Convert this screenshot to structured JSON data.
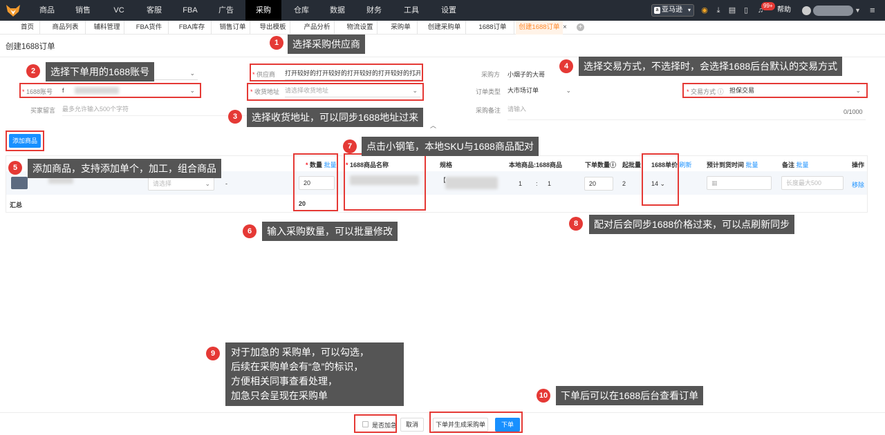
{
  "topnav": {
    "items": [
      "商品",
      "销售",
      "VC",
      "客服",
      "FBA",
      "广告",
      "采购",
      "仓库",
      "数据",
      "财务",
      "工具",
      "设置"
    ],
    "active": "采购",
    "marketplace": "亚马逊",
    "marketplace_icon": "a",
    "notification_badge": "99+",
    "help": "帮助"
  },
  "tabs": {
    "items": [
      "首页",
      "商品列表",
      "辅料管理",
      "FBA货件",
      "FBA库存",
      "销售订单",
      "导出模板",
      "产品分析",
      "物流设置",
      "采购单",
      "创建采购单",
      "1688订单",
      "创建1688订单"
    ],
    "active": "创建1688订单",
    "close": "×",
    "add": "+"
  },
  "page": {
    "title": "创建1688订单"
  },
  "form": {
    "supplier_label": "供应商",
    "supplier_value": "打开较好的打开较好的打开较好的打开较好的打开较",
    "purchaser_label": "采购方",
    "purchaser_value": "小烟子的大哥",
    "account_label": "1688账号",
    "account_prefix": "f",
    "address_label": "收货地址",
    "address_placeholder": "请选择收货地址",
    "order_type_label": "订单类型",
    "order_type_value": "大市场订单",
    "trade_label": "交易方式",
    "trade_value": "担保交易",
    "buyer_msg_label": "买家留言",
    "buyer_msg_placeholder": "最多允许输入500个字符",
    "remark_label": "采购备注",
    "remark_placeholder": "请输入",
    "remark_count": "0/1000"
  },
  "add_product_button": "添加商品",
  "table": {
    "headers": {
      "qty": "数量",
      "batch": "批量",
      "name_1688": "1688商品名称",
      "spec": "规格",
      "mapping": "本地商品:1688商品",
      "order_qty": "下单数量",
      "min_batch": "起批量",
      "unit_price": "1688单价",
      "refresh": "刷新",
      "eta": "预计到货时间",
      "note": "备注",
      "ops": "操作"
    },
    "row": {
      "select_placeholder": "请选择",
      "dash": "-",
      "qty": "20",
      "spec_prefix": "【",
      "ratio_left": "1",
      "ratio_colon": ":",
      "ratio_right": "1",
      "order_qty": "20",
      "min_batch": "2",
      "price": "14",
      "note_placeholder": "长度最大500",
      "remove": "移除"
    },
    "total_label": "汇总",
    "total_qty": "20"
  },
  "footer": {
    "urgent_label": "是否加急",
    "cancel": "取消",
    "order_and_po": "下单并生成采购单",
    "order": "下单"
  },
  "callouts": [
    {
      "n": "1",
      "text": "选择采购供应商"
    },
    {
      "n": "2",
      "text": "选择下单用的1688账号"
    },
    {
      "n": "3",
      "text": "选择收货地址，可以同步1688地址过来"
    },
    {
      "n": "4",
      "text": "选择交易方式，不选择时，会选择1688后台默认的交易方式"
    },
    {
      "n": "5",
      "text": "添加商品，支持添加单个，加工，组合商品"
    },
    {
      "n": "6",
      "text": "输入采购数量，可以批量修改"
    },
    {
      "n": "7",
      "text": "点击小钢笔，本地SKU与1688商品配对"
    },
    {
      "n": "8",
      "text": "配对后会同步1688价格过来，可以点刷新同步"
    },
    {
      "n": "9",
      "lines": [
        "对于加急的 采购单，可以勾选，",
        "后续在采购单会有“急”的标识，",
        "方便相关同事查看处理，",
        "加急只会呈现在采购单"
      ]
    },
    {
      "n": "10",
      "text": "下单后可以在1688后台查看订单"
    }
  ]
}
